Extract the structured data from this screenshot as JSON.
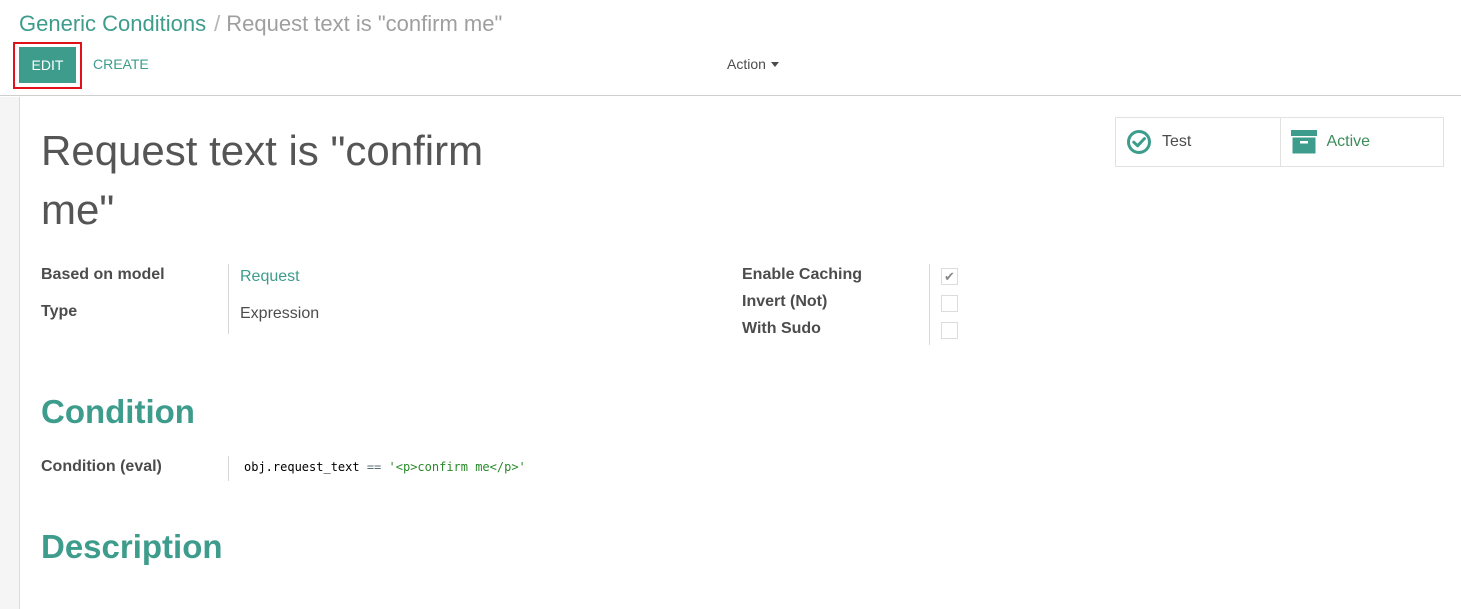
{
  "breadcrumb": {
    "parent": "Generic Conditions",
    "separator": "/",
    "current": "Request text is \"confirm me\""
  },
  "toolbar": {
    "edit_label": "EDIT",
    "create_label": "CREATE",
    "action_label": "Action"
  },
  "record": {
    "title_line1": "Request text is \"confirm",
    "title_line2": "me\""
  },
  "smart_buttons": {
    "test_label": "Test",
    "active_label": "Active",
    "test_icon": "check-circle-icon",
    "active_icon": "archive-icon",
    "test_icon_color": "#3d9c8c",
    "active_icon_color": "#3d9c8c"
  },
  "fields_left": {
    "model_label": "Based on model",
    "model_value": "Request",
    "type_label": "Type",
    "type_value": "Expression"
  },
  "fields_right": {
    "caching_label": "Enable Caching",
    "caching_checked": true,
    "invert_label": "Invert (Not)",
    "invert_checked": false,
    "sudo_label": "With Sudo",
    "sudo_checked": false
  },
  "condition_section": {
    "title": "Condition",
    "eval_label": "Condition (eval)",
    "code_object": "obj.request_text",
    "code_operator": "==",
    "code_string": "'<p>confirm me</p>'"
  },
  "description_section": {
    "title": "Description"
  },
  "colors": {
    "accent": "#3d9c8c",
    "highlight": "#e0111b",
    "active_green": "#3d8c5c"
  }
}
